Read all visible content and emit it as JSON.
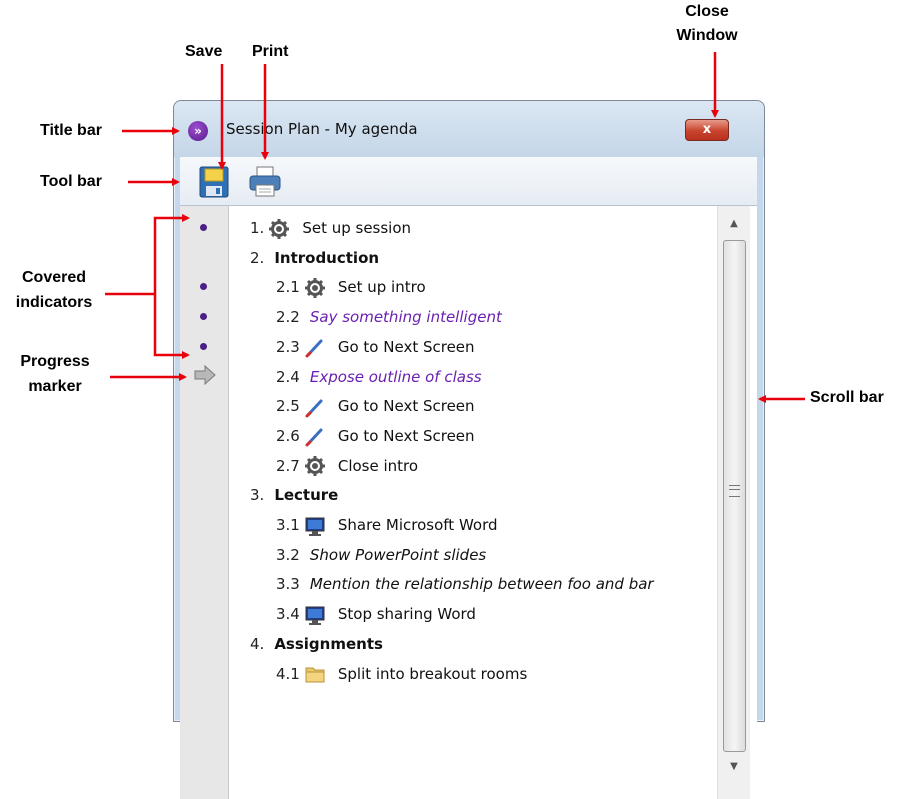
{
  "callouts": {
    "save": "Save",
    "print": "Print",
    "close_window": "Close\nWindow",
    "close_line1": "Close",
    "close_line2": "Window",
    "title_bar": "Title bar",
    "tool_bar": "Tool bar",
    "covered_line1": "Covered",
    "covered_line2": "indicators",
    "progress_line1": "Progress",
    "progress_line2": "marker",
    "scroll_bar": "Scroll bar"
  },
  "window": {
    "title": "Session Plan - My agenda",
    "close_glyph": "x"
  },
  "toolbar": {
    "save_icon": "floppy-disk-icon",
    "print_icon": "printer-icon"
  },
  "agenda": [
    {
      "num": "1.",
      "icon": "gear-icon",
      "text": "Set up session",
      "style": "normal",
      "covered": true
    },
    {
      "num": "2.",
      "icon": "",
      "text": "Introduction",
      "style": "section",
      "covered": false
    },
    {
      "num": "2.1",
      "icon": "gear-icon",
      "text": "Set up intro",
      "style": "normal",
      "covered": true
    },
    {
      "num": "2.2",
      "icon": "",
      "text": "Say something intelligent",
      "style": "purple",
      "covered": true
    },
    {
      "num": "2.3",
      "icon": "pen-icon",
      "text": "Go to Next Screen",
      "style": "normal",
      "covered": true
    },
    {
      "num": "2.4",
      "icon": "",
      "text": "Expose outline of class",
      "style": "purple",
      "covered": false
    },
    {
      "num": "2.5",
      "icon": "pen-icon",
      "text": "Go to Next Screen",
      "style": "normal",
      "covered": false
    },
    {
      "num": "2.6",
      "icon": "pen-icon",
      "text": "Go to Next Screen",
      "style": "normal",
      "covered": false
    },
    {
      "num": "2.7",
      "icon": "gear-icon",
      "text": "Close intro",
      "style": "normal",
      "covered": false
    },
    {
      "num": "3.",
      "icon": "",
      "text": "Lecture",
      "style": "section",
      "covered": false
    },
    {
      "num": "3.1",
      "icon": "monitor-icon",
      "text": "Share Microsoft Word",
      "style": "normal",
      "covered": false
    },
    {
      "num": "3.2",
      "icon": "",
      "text": "Show PowerPoint slides",
      "style": "italic",
      "covered": false
    },
    {
      "num": "3.3",
      "icon": "",
      "text": "Mention the relationship between foo and bar",
      "style": "italic",
      "covered": false
    },
    {
      "num": "3.4",
      "icon": "monitor-icon",
      "text": "Stop sharing Word",
      "style": "normal",
      "covered": false
    },
    {
      "num": "4.",
      "icon": "",
      "text": "Assignments",
      "style": "section",
      "covered": false
    },
    {
      "num": "4.1",
      "icon": "folder-icon",
      "text": "Split into breakout rooms",
      "style": "normal",
      "covered": false
    }
  ],
  "colors": {
    "arrow": "#e8000b",
    "covered_dot": "#4a1f86",
    "purple_text": "#6a1fb3"
  }
}
